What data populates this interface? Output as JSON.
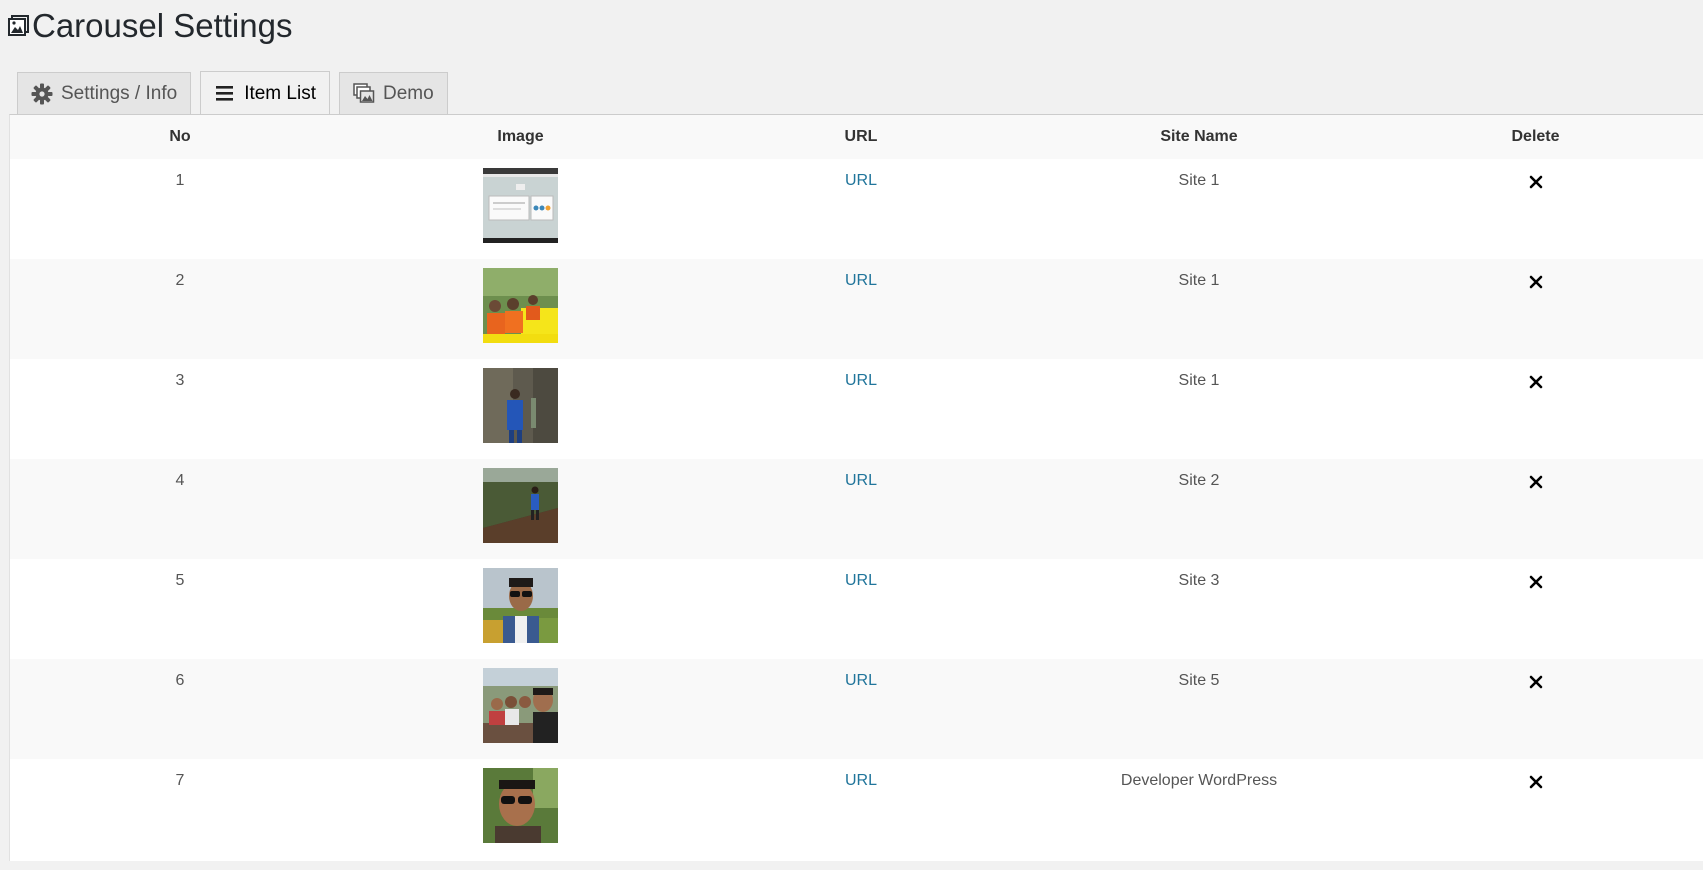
{
  "page": {
    "title": "Carousel Settings"
  },
  "tabs": [
    {
      "label": "Settings / Info",
      "icon": "gear-icon",
      "active": false
    },
    {
      "label": "Item List",
      "icon": "list-icon",
      "active": true
    },
    {
      "label": "Demo",
      "icon": "images-icon",
      "active": false
    }
  ],
  "table": {
    "headers": {
      "no": "No",
      "image": "Image",
      "url": "URL",
      "site_name": "Site Name",
      "delete": "Delete"
    },
    "rows": [
      {
        "no": "1",
        "url_label": "URL",
        "site_name": "Site 1",
        "image": "screenshot-thumbnail"
      },
      {
        "no": "2",
        "url_label": "URL",
        "site_name": "Site 1",
        "image": "group-boat-photo"
      },
      {
        "no": "3",
        "url_label": "URL",
        "site_name": "Site 1",
        "image": "hiker-photo"
      },
      {
        "no": "4",
        "url_label": "URL",
        "site_name": "Site 2",
        "image": "trail-photo"
      },
      {
        "no": "5",
        "url_label": "URL",
        "site_name": "Site 3",
        "image": "portrait-photo"
      },
      {
        "no": "6",
        "url_label": "URL",
        "site_name": "Site 5",
        "image": "selfie-group-photo"
      },
      {
        "no": "7",
        "url_label": "URL",
        "site_name": "Developer WordPress",
        "image": "portrait-sunglasses-photo"
      }
    ]
  },
  "colors": {
    "link": "#21759b",
    "background": "#f1f1f1",
    "row_alt": "#f9f9f9"
  }
}
